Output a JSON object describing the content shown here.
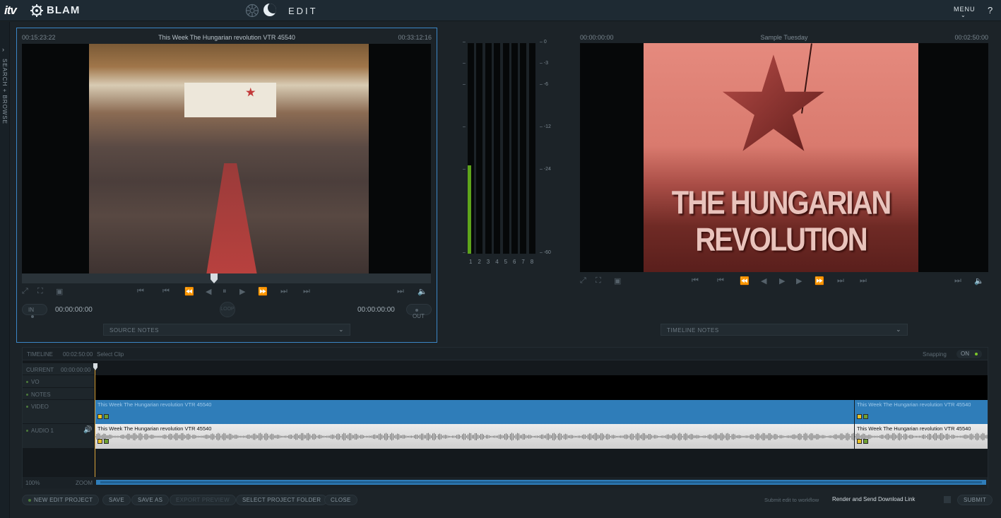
{
  "header": {
    "brand_itv": "itv",
    "brand_name": "BLAM",
    "page_title": "EDIT",
    "menu_label": "MENU",
    "menu_chevron": "⌄",
    "help_label": "?"
  },
  "side_rail": {
    "label": "SEARCH + BROWSE",
    "expand_icon": "›",
    "collapse_icon": "‹"
  },
  "source_viewer": {
    "tc_left": "00:15:23:22",
    "title": "This Week The Hungarian revolution VTR 45540",
    "tc_right": "00:33:12:16",
    "scrub_position": 0.47,
    "in_label": "IN",
    "in_timecode": "00:00:00:00",
    "out_timecode": "00:00:00:00",
    "out_label": "OUT",
    "center_button": "LOOP",
    "notes_label": "SOURCE NOTES"
  },
  "target_viewer": {
    "tc_left": "00:00:00:00",
    "title": "Sample Tuesday",
    "tc_right": "00:02:50:00",
    "video_caption": "THE HUNGARIAN REVOLUTION",
    "notes_label": "TIMELINE NOTES"
  },
  "controls": {
    "glyphs": [
      "⤢",
      "⛶",
      "▣",
      "⏮",
      "⏮",
      "⏪",
      "◀",
      "⏸",
      "▶",
      "⏩",
      "⏭",
      "⏭",
      "⏭",
      "≡"
    ]
  },
  "meter": {
    "scale": [
      "0",
      "-3",
      "-6",
      "-12",
      "-24",
      "-60"
    ],
    "channels": [
      "1",
      "2",
      "3",
      "4",
      "5",
      "6",
      "7",
      "8"
    ],
    "levels": [
      0.42,
      0,
      0,
      0,
      0,
      0,
      0,
      0
    ],
    "level_color": "#5ea51b"
  },
  "timeline": {
    "label": "TIMELINE",
    "duration": "00:02:50:00",
    "select_clip": "Select Clip",
    "snapping_label": "Snapping",
    "snapping_state": "ON",
    "current_label": "CURRENT",
    "current_tc": "00:00:00:00",
    "tracks": [
      {
        "label": "VO"
      },
      {
        "label": "NOTES"
      },
      {
        "label": "VIDEO"
      },
      {
        "label": "AUDIO 1"
      }
    ],
    "video_clips": [
      {
        "title": "This Week The Hungarian revolution VTR 45540",
        "start": 0.0,
        "end": 0.8502
      },
      {
        "title": "This Week The Hungarian revolution VTR 45540",
        "start": 0.8502,
        "end": 1.0
      }
    ],
    "audio_clips": [
      {
        "title": "This Week The Hungarian revolution VTR 45540",
        "start": 0.0,
        "end": 0.8502
      },
      {
        "title": "This Week The Hungarian revolution VTR 45540",
        "start": 0.8502,
        "end": 1.0
      }
    ],
    "zoom_percent": "100%",
    "zoom_label": "ZOOM",
    "video_color": "#2f7db9"
  },
  "bottom": {
    "new_project": "NEW EDIT PROJECT",
    "save": "SAVE",
    "save_as": "SAVE AS",
    "export_preview": "EXPORT PREVIEW",
    "select_folder": "SELECT PROJECT FOLDER",
    "close": "CLOSE",
    "workflow_label": "Submit edit to workflow",
    "workflow_value": "Render and Send Download Link",
    "submit": "SUBMIT"
  },
  "colors": {
    "accent": "#3b86c6",
    "snap_on": "#7cc729"
  }
}
